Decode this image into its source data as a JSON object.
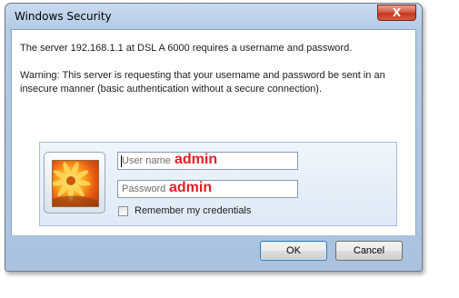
{
  "window": {
    "title": "Windows Security",
    "close_glyph": "X"
  },
  "message": {
    "line1": "The server 192.168.1.1 at DSL A 6000 requires a username and password.",
    "warning": "Warning: This server is requesting that your username and password be sent in an insecure manner (basic authentication without a secure connection)."
  },
  "credentials": {
    "avatar_icon": "user-avatar-flower-icon",
    "username": {
      "placeholder": "User name",
      "value": "admin"
    },
    "password": {
      "placeholder": "Password",
      "value": "admin"
    },
    "remember_label": "Remember my credentials",
    "remember_checked": false
  },
  "buttons": {
    "ok": "OK",
    "cancel": "Cancel"
  },
  "colors": {
    "annotation_text": "#e21f26",
    "ok_focus_border": "#3c7fb1",
    "close_button": "#c3371b"
  }
}
